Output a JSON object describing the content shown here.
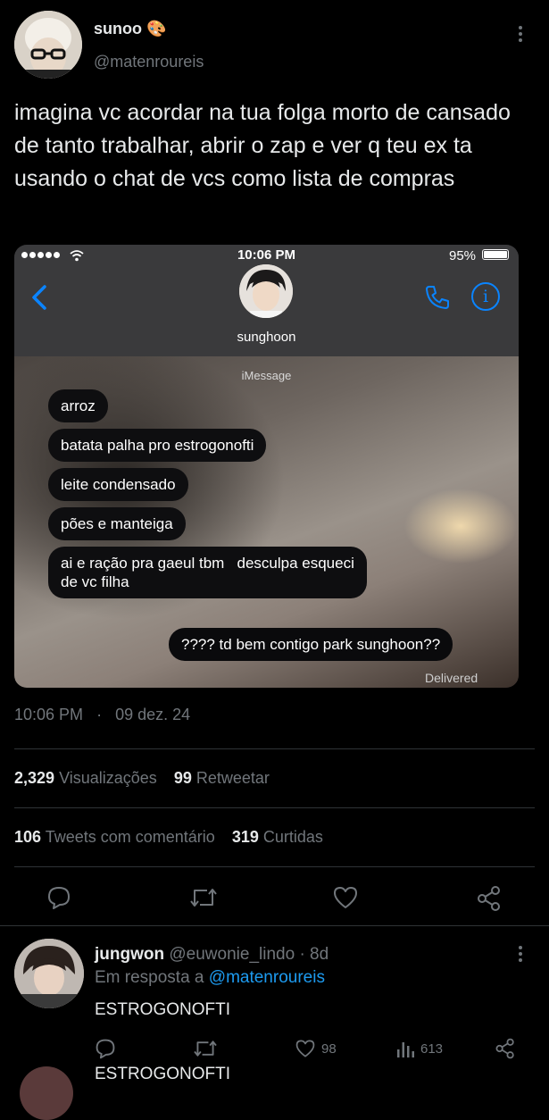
{
  "tweet": {
    "author_name": "sunoo",
    "author_emoji": "🎨",
    "author_handle": "@matenroureis",
    "text": "imagina vc acordar na tua folga morto de cansado de tanto trabalhar, abrir o zap e ver q teu ex ta usando o chat de vcs como lista de compras",
    "time": "10:06 PM",
    "date": "09 dez. 24",
    "views_count": "2,329",
    "views_label": "Visualizações",
    "retweets_count": "99",
    "retweets_label": "Retweetar",
    "quotes_count": "106",
    "quotes_label": "Tweets com comentário",
    "likes_count": "319",
    "likes_label": "Curtidas"
  },
  "embed": {
    "status_time": "10:06 PM",
    "battery": "95%",
    "contact_name": "sunghoon",
    "service_label": "iMessage",
    "messages": [
      "arroz",
      "batata palha pro estrogonofti",
      "leite condensado",
      "pões e manteiga",
      "ai e ração pra gaeul tbm   desculpa esqueci\nde vc filha"
    ],
    "my_message": "???? td bem contigo park sunghoon??",
    "delivered": "Delivered"
  },
  "reply": {
    "author_name": "jungwon",
    "author_handle": "@euwonie_lindo",
    "age": "· 8d",
    "in_reply_prefix": "Em resposta a",
    "in_reply_handle": "@matenroureis",
    "text": "ESTROGONOFTI",
    "likes": "98",
    "views": "613"
  },
  "next_preview": "ESTROGONOFTI",
  "colors": {
    "accent": "#1d9bf0",
    "muted": "#71767b",
    "ios_blue": "#0a84ff"
  }
}
